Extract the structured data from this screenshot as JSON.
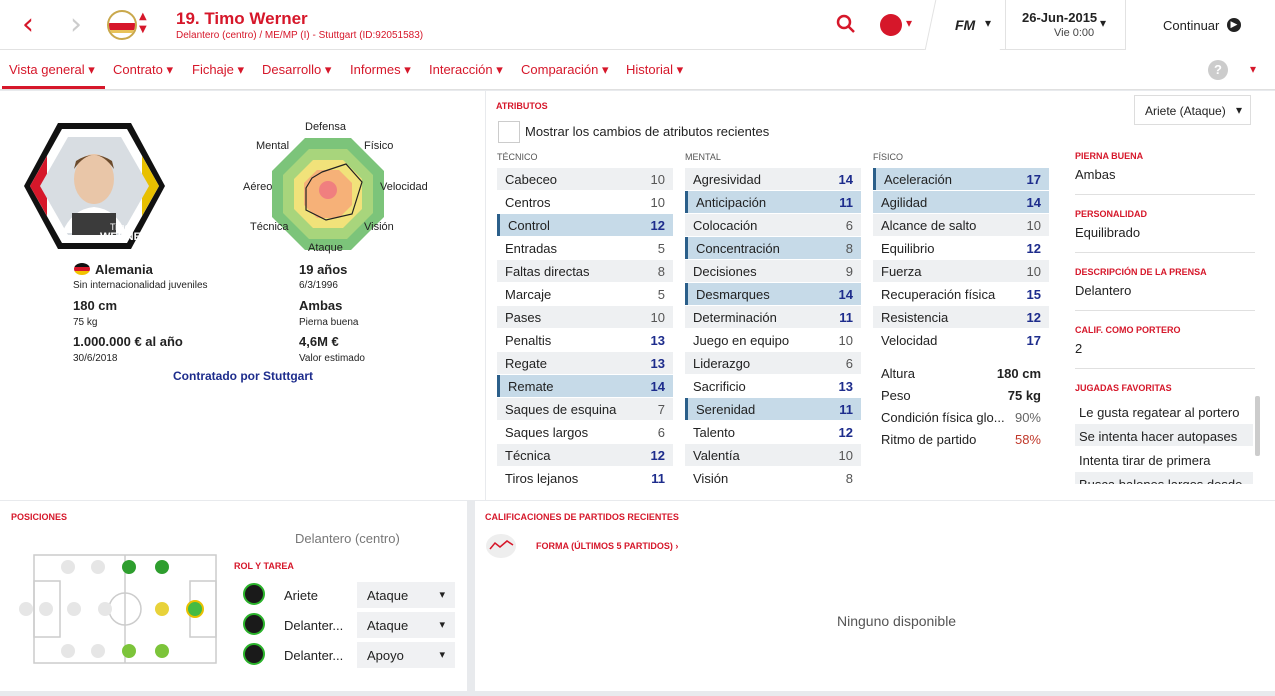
{
  "header": {
    "title": "19. Timo Werner",
    "subtitle": "Delantero (centro) / ME/MP (I) - Stuttgart (ID:92051583)",
    "fm_label": "FM",
    "date": "26-Jun-2015",
    "day": "Vie 0:00",
    "continue_label": "Continuar"
  },
  "tabs": [
    "Vista general",
    "Contrato",
    "Fichaje",
    "Desarrollo",
    "Informes",
    "Interacción",
    "Comparación",
    "Historial"
  ],
  "profile": {
    "card_name_small": "Timo",
    "card_name_big": "WERNER",
    "radar_labels": {
      "top": "Defensa",
      "tr": "Físico",
      "r": "Velocidad",
      "br": "Visión",
      "bottom": "Ataque",
      "bl": "Técnica",
      "l": "Aéreo",
      "tl": "Mental"
    },
    "nationality": "Alemania",
    "nationality_sub": "Sin internacionalidad juveniles",
    "height": "180 cm",
    "weight": "75 kg",
    "wage": "1.000.000 € al año",
    "contract_end": "30/6/2018",
    "age": "19 años",
    "dob": "6/3/1996",
    "foot": "Ambas",
    "foot_label": "Pierna buena",
    "value": "4,6M €",
    "value_label": "Valor estimado",
    "contracted_by": "Contratado por Stuttgart"
  },
  "attributes": {
    "title": "ATRIBUTOS",
    "checkbox_label": "Mostrar los cambios de atributos recientes",
    "role_select": "Ariete (Ataque)",
    "technical_title": "TÉCNICO",
    "mental_title": "MENTAL",
    "physical_title": "FÍSICO",
    "technical": [
      {
        "name": "Cabeceo",
        "value": "10"
      },
      {
        "name": "Centros",
        "value": "10"
      },
      {
        "name": "Control",
        "value": "12"
      },
      {
        "name": "Entradas",
        "value": "5"
      },
      {
        "name": "Faltas directas",
        "value": "8"
      },
      {
        "name": "Marcaje",
        "value": "5"
      },
      {
        "name": "Pases",
        "value": "10"
      },
      {
        "name": "Penaltis",
        "value": "13"
      },
      {
        "name": "Regate",
        "value": "13"
      },
      {
        "name": "Remate",
        "value": "14"
      },
      {
        "name": "Saques de esquina",
        "value": "7"
      },
      {
        "name": "Saques largos",
        "value": "6"
      },
      {
        "name": "Técnica",
        "value": "12"
      },
      {
        "name": "Tiros lejanos",
        "value": "11"
      }
    ],
    "mental": [
      {
        "name": "Agresividad",
        "value": "14"
      },
      {
        "name": "Anticipación",
        "value": "11"
      },
      {
        "name": "Colocación",
        "value": "6"
      },
      {
        "name": "Concentración",
        "value": "8"
      },
      {
        "name": "Decisiones",
        "value": "9"
      },
      {
        "name": "Desmarques",
        "value": "14"
      },
      {
        "name": "Determinación",
        "value": "11"
      },
      {
        "name": "Juego en equipo",
        "value": "10"
      },
      {
        "name": "Liderazgo",
        "value": "6"
      },
      {
        "name": "Sacrificio",
        "value": "13"
      },
      {
        "name": "Serenidad",
        "value": "11"
      },
      {
        "name": "Talento",
        "value": "12"
      },
      {
        "name": "Valentía",
        "value": "10"
      },
      {
        "name": "Visión",
        "value": "8"
      }
    ],
    "physical": [
      {
        "name": "Aceleración",
        "value": "17"
      },
      {
        "name": "Agilidad",
        "value": "14"
      },
      {
        "name": "Alcance de salto",
        "value": "10"
      },
      {
        "name": "Equilibrio",
        "value": "12"
      },
      {
        "name": "Fuerza",
        "value": "10"
      },
      {
        "name": "Recuperación física",
        "value": "15"
      },
      {
        "name": "Resistencia",
        "value": "12"
      },
      {
        "name": "Velocidad",
        "value": "17"
      }
    ],
    "extra": [
      {
        "name": "Altura",
        "value": "180 cm"
      },
      {
        "name": "Peso",
        "value": "75 kg"
      },
      {
        "name": "Condición física glo...",
        "value": "90%"
      },
      {
        "name": "Ritmo de partido",
        "value": "58%"
      }
    ]
  },
  "side_info": {
    "foot_title": "PIERNA BUENA",
    "foot": "Ambas",
    "personality_title": "PERSONALIDAD",
    "personality": "Equilibrado",
    "press_title": "DESCRIPCIÓN DE LA PRENSA",
    "press": "Delantero",
    "gk_title": "CALIF. COMO PORTERO",
    "gk": "2",
    "plays_title": "JUGADAS FAVORITAS",
    "plays": [
      "Le gusta regatear al portero",
      "Se intenta hacer autopases",
      "Intenta tirar de primera",
      "Busca balones largos desde ..."
    ]
  },
  "positions": {
    "title": "POSICIONES",
    "current": "Delantero (centro)",
    "role_title": "ROL Y TAREA",
    "roles": [
      {
        "role": "Ariete",
        "duty": "Ataque"
      },
      {
        "role": "Delanter...",
        "duty": "Ataque"
      },
      {
        "role": "Delanter...",
        "duty": "Apoyo"
      }
    ]
  },
  "ratings": {
    "title": "CALIFICACIONES DE PARTIDOS RECIENTES",
    "form_label": "FORMA (ÚLTIMOS 5 PARTIDOS) ›",
    "empty": "Ninguno disponible"
  },
  "colors": {
    "accent": "#d6172a",
    "highlight": "#c6dae8",
    "good": "#1d2c8c"
  }
}
